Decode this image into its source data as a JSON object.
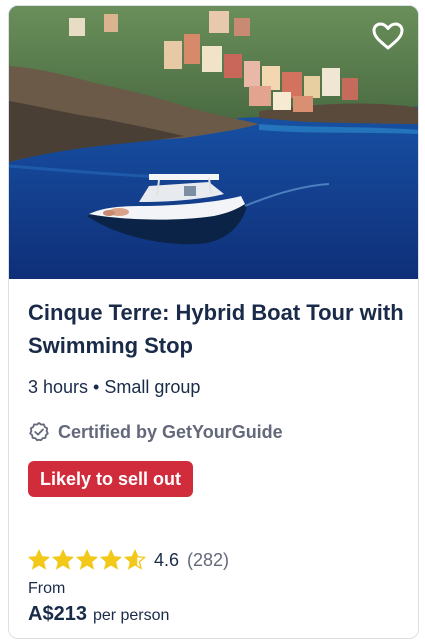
{
  "card": {
    "photo_alt": "Boat on blue sea below Cinque Terre cliff village",
    "wishlist_icon": "heart-outline-icon",
    "title": "Cinque Terre: Hybrid Boat Tour with Swimming Stop",
    "meta": "3 hours • Small group",
    "certified_icon": "certified-badge-icon",
    "certified_label": "Certified by GetYourGuide",
    "badge_label": "Likely to sell out",
    "rating": {
      "score": 4.6,
      "score_text": "4.6",
      "count_text": "(282)",
      "star_icon": "star-icon"
    },
    "from_label": "From",
    "price": "A$213",
    "price_unit": "per person"
  },
  "colors": {
    "title": "#1a2b49",
    "muted": "#63687a",
    "badge": "#d12c3c",
    "star": "#f2c81b",
    "sea": "#1a4fa0"
  }
}
